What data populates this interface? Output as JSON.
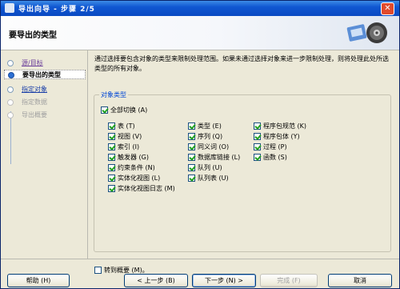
{
  "window": {
    "title": "导出向导 - 步骤 2/5"
  },
  "banner": {
    "title": "要导出的类型"
  },
  "steps": [
    {
      "label": "源/目标"
    },
    {
      "label": "要导出的类型"
    },
    {
      "label": "指定对象"
    },
    {
      "label": "指定数据"
    },
    {
      "label": "导出概要"
    }
  ],
  "description": "通过选择要包含对象的类型来限制处理范围。如果未通过选择对象来进一步限制处理，则将处理此处所选类型的所有对象。",
  "group": {
    "title": "对象类型",
    "toggle_all": "全部切换 (A)",
    "col1": [
      "表 (T)",
      "视图 (V)",
      "索引 (I)",
      "触发器 (G)",
      "约束条件 (N)",
      "实体化视图 (L)",
      "实体化视图日志 (M)"
    ],
    "col2": [
      "类型 (E)",
      "序列 (Q)",
      "同义词 (O)",
      "数据库链接 (L)",
      "队列 (U)",
      "队列表 (U)"
    ],
    "col3": [
      "程序包规范 (K)",
      "程序包体 (Y)",
      "过程 (P)",
      "函数 (S)"
    ]
  },
  "skip_summary": "转到概要 (M)。",
  "buttons": {
    "help": "帮助 (H)",
    "back": "< 上一步 (B)",
    "next": "下一步 (N) >",
    "finish": "完成 (F)",
    "cancel": "取消"
  }
}
